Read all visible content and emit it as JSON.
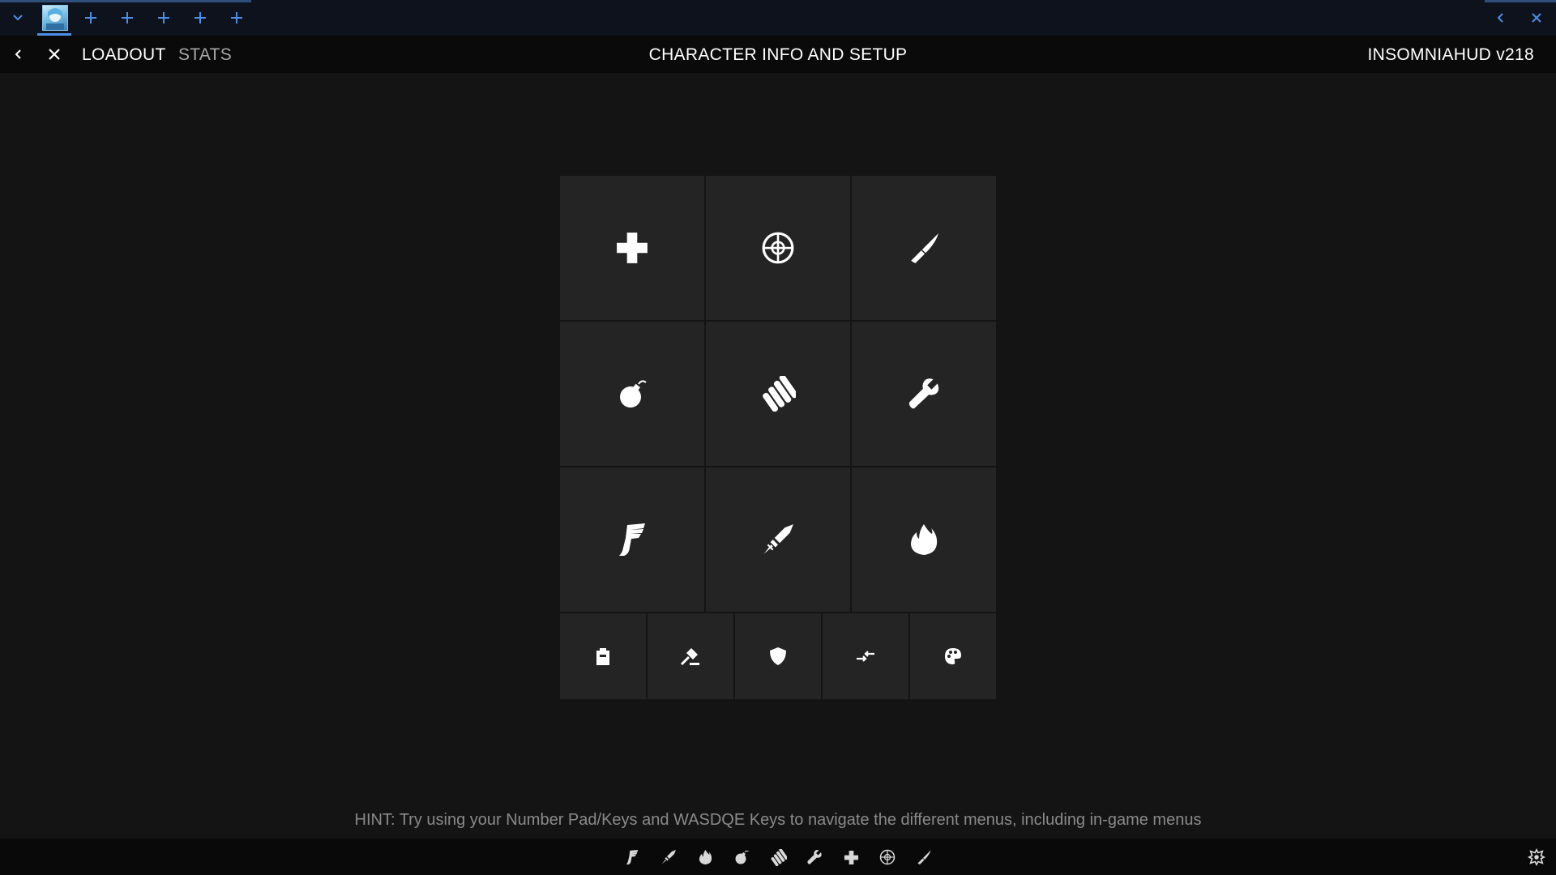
{
  "topbar": {
    "menu_icon": "chevron-down-icon",
    "new_tab_icon": "plus-icon",
    "nav_back_icon": "chevron-left-icon",
    "close_icon": "close-icon",
    "accent": "#4c8fe6"
  },
  "header": {
    "back_icon": "chevron-left-icon",
    "close_icon": "close-icon",
    "tabs": [
      {
        "label": "LOADOUT",
        "active": true
      },
      {
        "label": "STATS",
        "active": false
      }
    ],
    "title": "CHARACTER INFO AND SETUP",
    "version": "INSOMNIAHUD v218"
  },
  "grid": {
    "main_tiles": [
      "medic-cross-icon",
      "crosshair-icon",
      "knife-icon",
      "grenade-icon",
      "ammo-icon",
      "wrench-icon",
      "winged-boot-icon",
      "syringe-icon",
      "fire-icon"
    ],
    "bottom_tiles": [
      "backpack-icon",
      "gavel-icon",
      "shield-icon",
      "swap-arrows-icon",
      "palette-icon"
    ]
  },
  "hint": "HINT: Try using your Number Pad/Keys and WASDQE Keys to navigate the different menus, including in-game menus",
  "bottombar": {
    "icons": [
      "winged-boot-icon",
      "syringe-icon",
      "fire-icon",
      "grenade-icon",
      "ammo-icon",
      "wrench-icon",
      "medic-cross-icon",
      "crosshair-icon",
      "knife-icon"
    ],
    "corner_icon": "emblem-icon"
  },
  "colors": {
    "background": "#141414",
    "tile": "#242424",
    "header": "#0a0a0a",
    "hint_text": "#8a8a8a"
  }
}
